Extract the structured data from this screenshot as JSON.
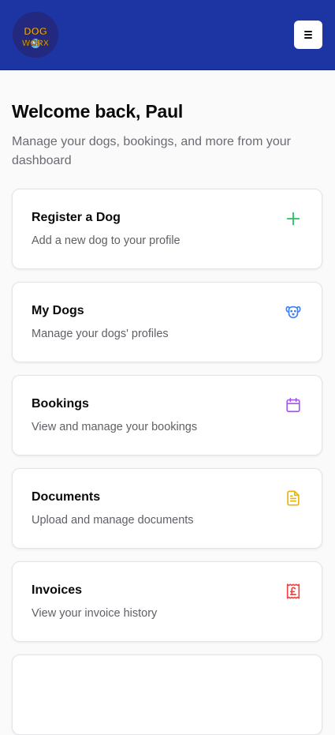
{
  "header": {
    "logo_text_top": "DOG",
    "logo_text_bottom": "WORX",
    "menu_icon": "hamburger-icon"
  },
  "greeting": {
    "title": "Welcome back, Paul",
    "subtitle": "Manage your dogs, bookings, and more from your dashboard"
  },
  "cards": [
    {
      "title": "Register a Dog",
      "description": "Add a new dog to your profile",
      "icon": "plus-icon",
      "color": "#22c55e"
    },
    {
      "title": "My Dogs",
      "description": "Manage your dogs' profiles",
      "icon": "dog-icon",
      "color": "#3b82f6"
    },
    {
      "title": "Bookings",
      "description": "View and manage your bookings",
      "icon": "calendar-icon",
      "color": "#a855f7"
    },
    {
      "title": "Documents",
      "description": "Upload and manage documents",
      "icon": "document-icon",
      "color": "#eab308"
    },
    {
      "title": "Invoices",
      "description": "View your invoice history",
      "icon": "receipt-pound-icon",
      "color": "#ef4444"
    }
  ],
  "colors": {
    "header_bg": "#1d34a3",
    "page_bg": "#fafafa"
  }
}
